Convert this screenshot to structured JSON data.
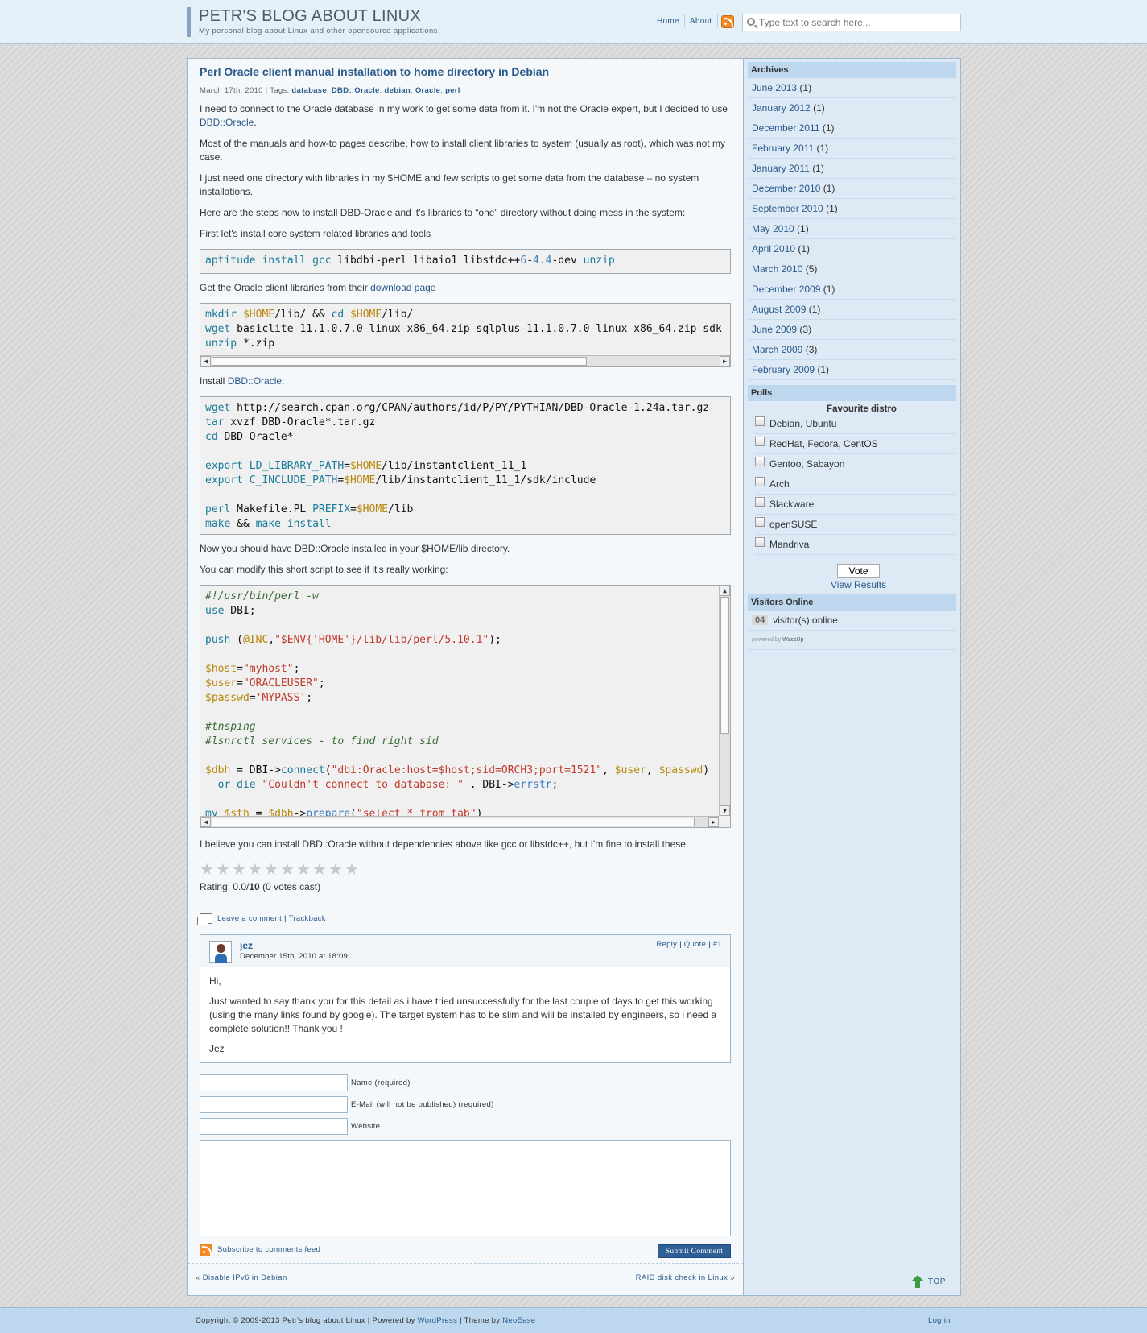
{
  "header": {
    "title": "PETR'S BLOG ABOUT LINUX",
    "description": "My personal blog about Linux and other opensource applications.",
    "nav": [
      "Home",
      "About"
    ],
    "search_placeholder": "Type text to search here..."
  },
  "post": {
    "title": "Perl Oracle client manual installation to home directory in Debian",
    "date": "March 17th, 2010 | Tags: ",
    "tags": [
      "database",
      "DBD::Oracle",
      "debian",
      "Oracle",
      "perl"
    ],
    "p1": "I need to connect to the Oracle database in my work to get some data from it. I'm not the Oracle expert, but I decided to use ",
    "p1_link": "DBD::Oracle",
    "p2": "Most of the manuals and how-to pages describe, how to install client libraries to system (usually as root), which was not my case.",
    "p3": "I just need one directory with libraries in my $HOME and few scripts to get some data from the database – no system installations.",
    "p4": "Here are the steps how to install DBD-Oracle and it's libraries to “one” directory without doing mess in the system:",
    "p5": "First let's install core system related libraries and tools",
    "p6": "Get the Oracle client libraries from their ",
    "p6_link": "download page",
    "p7": "Install ",
    "p7_link": "DBD::Oracle",
    "p8": "Now you should have DBD::Oracle installed in your $HOME/lib directory.",
    "p9": "You can modify this short script to see if it's really working:",
    "p10": "I believe you can install DBD::Oracle without dependencies above like gcc or libstdc++, but I'm fine to install these.",
    "rating_prefix": "Rating: 0.0/",
    "rating_max": "10",
    "rating_suffix": " (0 votes cast)",
    "rating_value": 0,
    "leave_comment": "Leave a comment",
    "trackback": "Trackback"
  },
  "comment": {
    "author": "jez",
    "date": "December 15th, 2010 at 18:09",
    "reply": "Reply",
    "quote": "Quote",
    "num": "#1",
    "lines": [
      "Hi,",
      "Just wanted to say thank you for this detail as i have tried unsuccessfully for the last couple of days to get this working (using the many links found by google). The target system has to be slim and will be installed by engineers, so i need a complete solution!! Thank you !",
      "Jez"
    ]
  },
  "form": {
    "name_label": "Name (required)",
    "email_label": "E-Mail (will not be published) (required)",
    "website_label": "Website",
    "subscribe": "Subscribe to comments feed",
    "submit": "Submit Comment"
  },
  "postnav": {
    "prev": "Disable IPv6 in Debian",
    "next": "RAID disk check in Linux"
  },
  "sidebar": {
    "archives_title": "Archives",
    "archives": [
      {
        "month": "June 2013",
        "count": "(1)"
      },
      {
        "month": "January 2012",
        "count": "(1)"
      },
      {
        "month": "December 2011",
        "count": "(1)"
      },
      {
        "month": "February 2011",
        "count": "(1)"
      },
      {
        "month": "January 2011",
        "count": "(1)"
      },
      {
        "month": "December 2010",
        "count": "(1)"
      },
      {
        "month": "September 2010",
        "count": "(1)"
      },
      {
        "month": "May 2010",
        "count": "(1)"
      },
      {
        "month": "April 2010",
        "count": "(1)"
      },
      {
        "month": "March 2010",
        "count": "(5)"
      },
      {
        "month": "December 2009",
        "count": "(1)"
      },
      {
        "month": "August 2009",
        "count": "(1)"
      },
      {
        "month": "June 2009",
        "count": "(3)"
      },
      {
        "month": "March 2009",
        "count": "(3)"
      },
      {
        "month": "February 2009",
        "count": "(1)"
      }
    ],
    "polls_title": "Polls",
    "poll_question": "Favourite distro",
    "poll_options": [
      "Debian, Ubuntu",
      "RedHat, Fedora, CentOS",
      "Gentoo, Sabayon",
      "Arch",
      "Slackware",
      "openSUSE",
      "Mandriva"
    ],
    "vote": "Vote",
    "view_results": "View Results",
    "visitors_title": "Visitors Online",
    "visitors_count": "04",
    "visitors_text": "visitor(s) online",
    "powered": "powered by",
    "powered_name": "WassUp",
    "top": "TOP"
  },
  "footer": {
    "copyright": "Copyright © 2009-2013 Petr's blog about Linux | Powered by ",
    "wordpress": "WordPress",
    "theme_by": " | Theme by ",
    "neoease": "NeoEase",
    "login": "Log in"
  }
}
